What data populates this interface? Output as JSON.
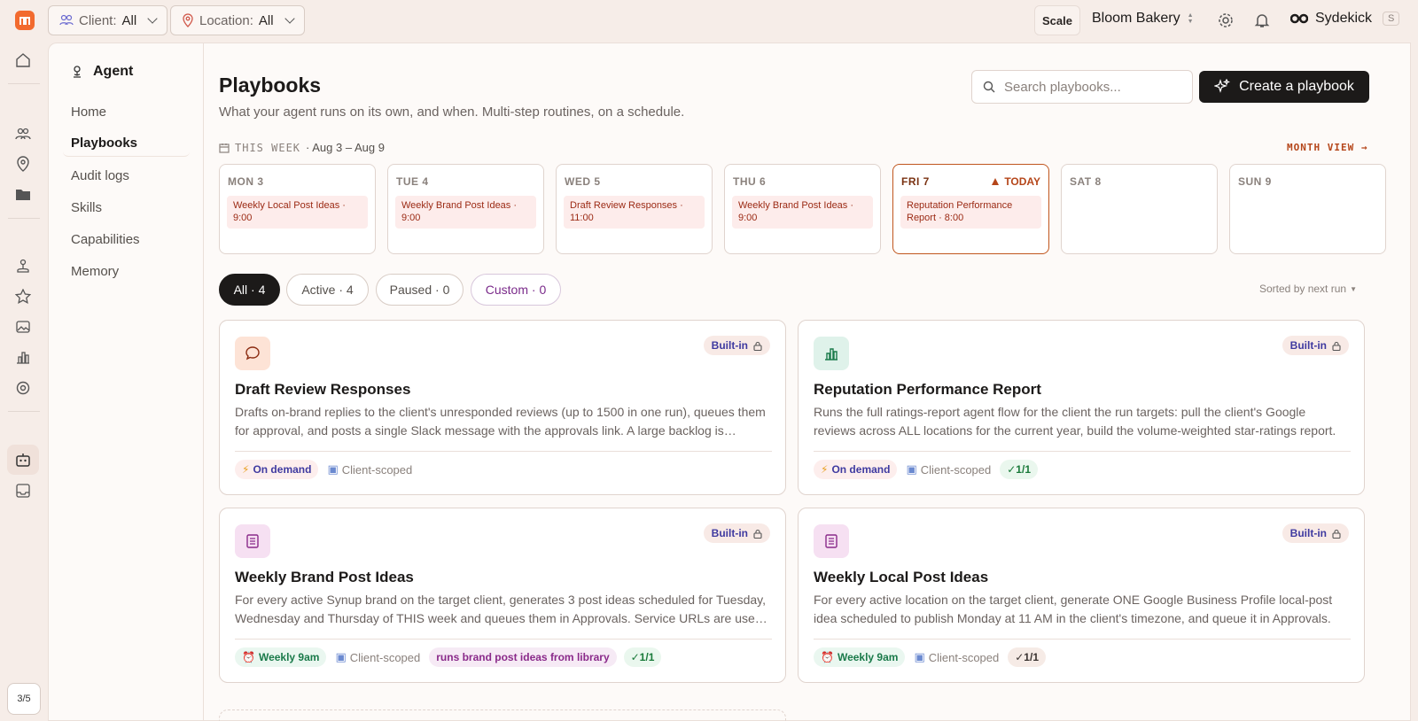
{
  "topbar": {
    "client_label": "Client:",
    "client_value": "All",
    "location_label": "Location:",
    "location_value": "All",
    "scale_button": "Scale",
    "org_name": "Bloom Bakery",
    "assistant_name": "Sydekick",
    "assistant_shortcut": "S"
  },
  "rail": {
    "page_indicator": "3/5"
  },
  "subnav": {
    "title": "Agent",
    "items": [
      {
        "label": "Home"
      },
      {
        "label": "Playbooks"
      },
      {
        "label": "Audit logs"
      },
      {
        "label": "Skills"
      },
      {
        "label": "Capabilities"
      },
      {
        "label": "Memory"
      }
    ]
  },
  "header": {
    "title": "Playbooks",
    "subtitle": "What your agent runs on its own, and when. Multi-step routines, on a schedule.",
    "search_placeholder": "Search playbooks...",
    "create_button": "Create a playbook"
  },
  "week": {
    "label": "THIS WEEK",
    "range": "· Aug 3 – Aug 9",
    "month_view": "MONTH VIEW →",
    "today_label": "TODAY",
    "days": [
      {
        "name": "MON 3",
        "event": "Weekly Local Post Ideas · 9:00"
      },
      {
        "name": "TUE 4",
        "event": "Weekly Brand Post Ideas · 9:00"
      },
      {
        "name": "WED 5",
        "event": "Draft Review Responses · 11:00"
      },
      {
        "name": "THU 6",
        "event": "Weekly Brand Post Ideas · 9:00"
      },
      {
        "name": "FRI 7",
        "event": "Reputation Performance Report · 8:00"
      },
      {
        "name": "SAT 8",
        "event": ""
      },
      {
        "name": "SUN 9",
        "event": ""
      }
    ]
  },
  "filters": {
    "all": "All · 4",
    "active": "Active · 4",
    "paused": "Paused · 0",
    "custom": "Custom · 0",
    "sorted": "Sorted by next run"
  },
  "cards": [
    {
      "title": "Draft Review Responses",
      "description": "Drafts on-brand replies to the client's unresponded reviews (up to 1500 in one run), queues them for approval, and posts a single Slack message with the approvals link. A large backlog is processed in batches.",
      "badge": "Built-in",
      "trigger": "On demand",
      "scope": "Client-scoped",
      "extra": "",
      "runs": ""
    },
    {
      "title": "Reputation Performance Report",
      "description": "Runs the full ratings-report agent flow for the client the run targets: pull the client's Google reviews across ALL locations for the current year, build the volume-weighted star-ratings report.",
      "badge": "Built-in",
      "trigger": "On demand",
      "scope": "Client-scoped",
      "extra": "",
      "runs": "✓1/1"
    },
    {
      "title": "Weekly Brand Post Ideas",
      "description": "For every active Synup brand on the target client, generates 3 post ideas scheduled for Tuesday, Wednesday and Thursday of THIS week and queues them in Approvals. Service URLs are used where available.",
      "badge": "Built-in",
      "trigger": "Weekly 9am",
      "scope": "Client-scoped",
      "extra": "runs brand post ideas from library",
      "runs": "✓1/1"
    },
    {
      "title": "Weekly Local Post Ideas",
      "description": "For every active location on the target client, generate ONE Google Business Profile local-post idea scheduled to publish Monday at 11 AM in the client's timezone, and queue it in Approvals.",
      "badge": "Built-in",
      "trigger": "Weekly 9am",
      "scope": "Client-scoped",
      "extra": "",
      "runs": "✓1/1"
    }
  ]
}
